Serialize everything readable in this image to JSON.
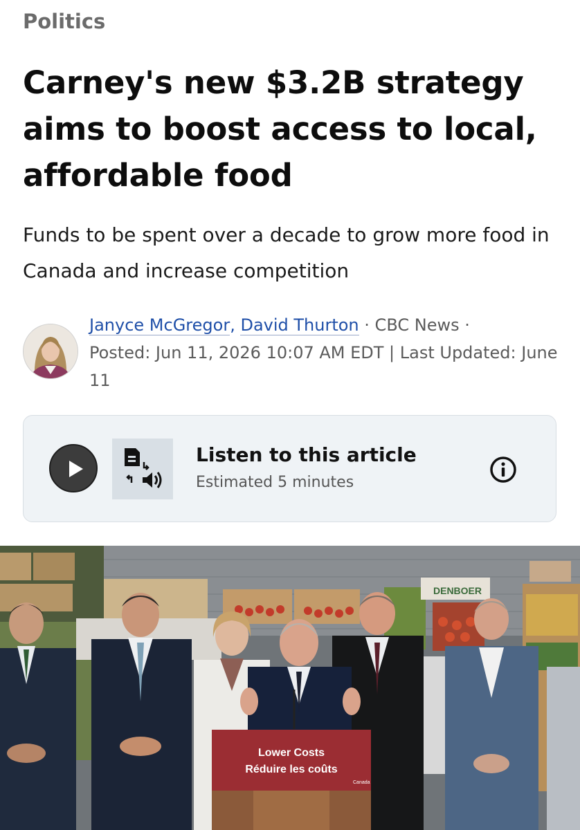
{
  "section": "Politics",
  "headline": "Carney's new $3.2B strategy aims to boost access to local, affordable food",
  "subheadline": "Funds to be spent over a decade to grow more food in Canada and increase competition",
  "byline": {
    "authors": [
      "Janyce McGregor",
      "David Thurton"
    ],
    "separator": ",",
    "outlet": "· CBC News ·",
    "posted": "Posted: Jun 11, 2026 10:07 AM EDT | Last Updated: June 11"
  },
  "listen": {
    "title": "Listen to this article",
    "estimate": "Estimated 5 minutes",
    "play_icon": "play-icon",
    "audio_icon": "text-to-speech-icon",
    "info_icon": "info-icon"
  },
  "photo": {
    "podium_line1": "Lower Costs",
    "podium_line2": "Réduire les coûts",
    "podium_mark": "Canada",
    "crate_label": "DENBOER"
  },
  "colors": {
    "link": "#1f4fa8",
    "card_bg": "#eff3f6",
    "podium_red": "#9b2d33"
  }
}
